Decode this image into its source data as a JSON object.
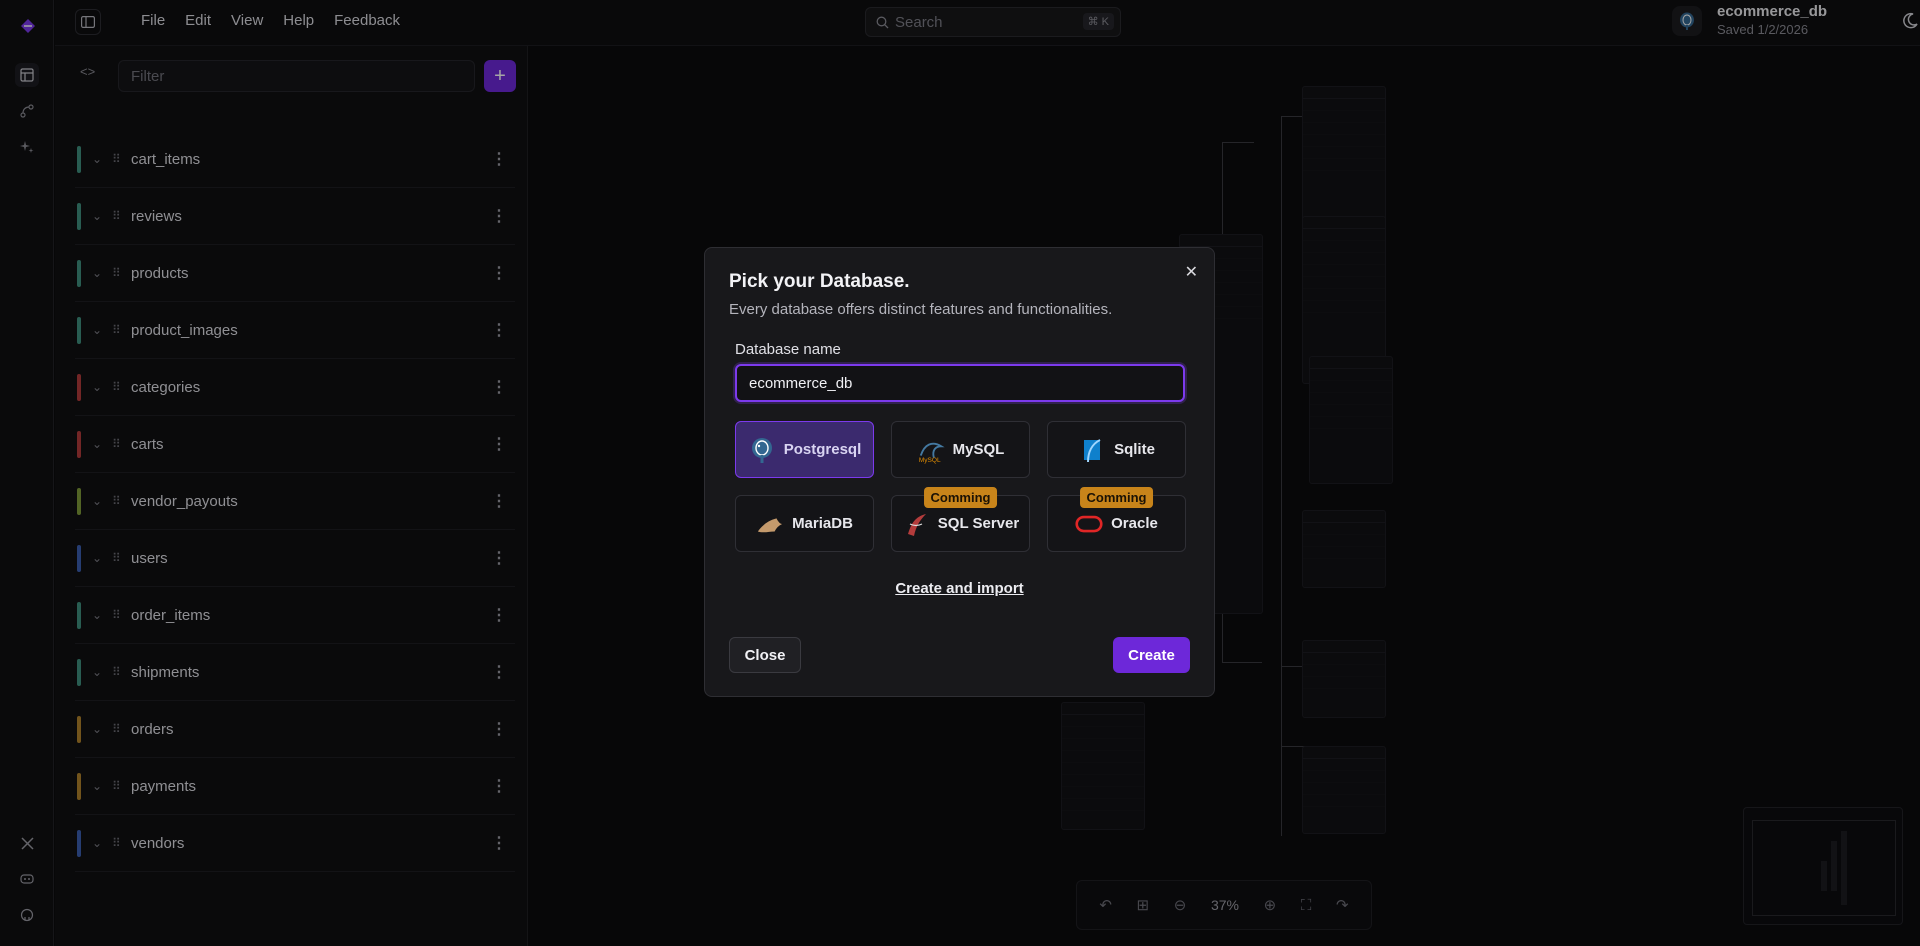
{
  "menu": [
    "File",
    "Edit",
    "View",
    "Help",
    "Feedback"
  ],
  "search": {
    "placeholder": "Search",
    "shortcut": "⌘ K"
  },
  "project": {
    "name": "ecommerce_db",
    "saved": "Saved 1/2/2026"
  },
  "panel": {
    "filter_placeholder": "Filter",
    "add_label": "+",
    "tables": [
      {
        "name": "cart_items",
        "color": "#3f8f7e"
      },
      {
        "name": "reviews",
        "color": "#3f8f7e"
      },
      {
        "name": "products",
        "color": "#3f8f7e"
      },
      {
        "name": "product_images",
        "color": "#3f8f7e"
      },
      {
        "name": "categories",
        "color": "#b13b3b"
      },
      {
        "name": "carts",
        "color": "#b13b3b"
      },
      {
        "name": "vendor_payouts",
        "color": "#7f9a3a"
      },
      {
        "name": "users",
        "color": "#3b5fb0"
      },
      {
        "name": "order_items",
        "color": "#3f8f7e"
      },
      {
        "name": "shipments",
        "color": "#3f8f7e"
      },
      {
        "name": "orders",
        "color": "#b0822c"
      },
      {
        "name": "payments",
        "color": "#b0822c"
      },
      {
        "name": "vendors",
        "color": "#3b5fb0"
      }
    ]
  },
  "zoom": {
    "level": "37%"
  },
  "modal": {
    "title": "Pick your Database.",
    "subtitle": "Every database offers distinct features and functionalities.",
    "name_label": "Database name",
    "name_value": "ecommerce_db",
    "options": [
      {
        "name": "Postgresql",
        "icon": "postgresql-icon",
        "selected": true,
        "badge": ""
      },
      {
        "name": "MySQL",
        "icon": "mysql-icon",
        "selected": false,
        "badge": ""
      },
      {
        "name": "Sqlite",
        "icon": "sqlite-icon",
        "selected": false,
        "badge": ""
      },
      {
        "name": "MariaDB",
        "icon": "mariadb-icon",
        "selected": false,
        "badge": ""
      },
      {
        "name": "SQL Server",
        "icon": "sqlserver-icon",
        "selected": false,
        "badge": "Comming"
      },
      {
        "name": "Oracle",
        "icon": "oracle-icon",
        "selected": false,
        "badge": "Comming"
      }
    ],
    "import_label": "Create and import",
    "close_label": "Close",
    "create_label": "Create"
  },
  "colors": {
    "accent": "#6d28d9",
    "badge": "#c8841a"
  }
}
